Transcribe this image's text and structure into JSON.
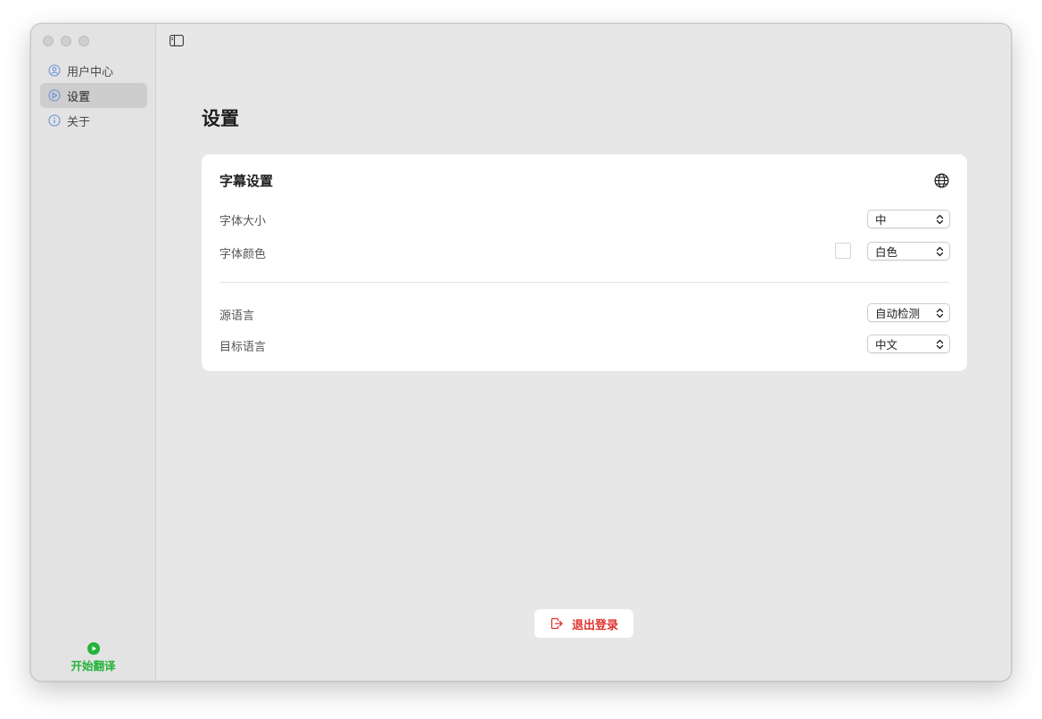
{
  "sidebar": {
    "items": [
      {
        "label": "用户中心",
        "icon": "user-circle-icon"
      },
      {
        "label": "设置",
        "icon": "settings-icon"
      },
      {
        "label": "关于",
        "icon": "info-icon"
      }
    ],
    "active_index": 1,
    "start_label": "开始翻译"
  },
  "page": {
    "title": "设置"
  },
  "subtitle_settings": {
    "title": "字幕设置",
    "font_size": {
      "label": "字体大小",
      "value": "中"
    },
    "font_color": {
      "label": "字体颜色",
      "value": "白色",
      "swatch": "#ffffff"
    },
    "source_language": {
      "label": "源语言",
      "value": "自动检测"
    },
    "target_language": {
      "label": "目标语言",
      "value": "中文"
    }
  },
  "logout": {
    "label": "退出登录"
  },
  "colors": {
    "accent_green": "#22b338",
    "danger_red": "#e0322e",
    "icon_blue": "#6a93d8"
  }
}
